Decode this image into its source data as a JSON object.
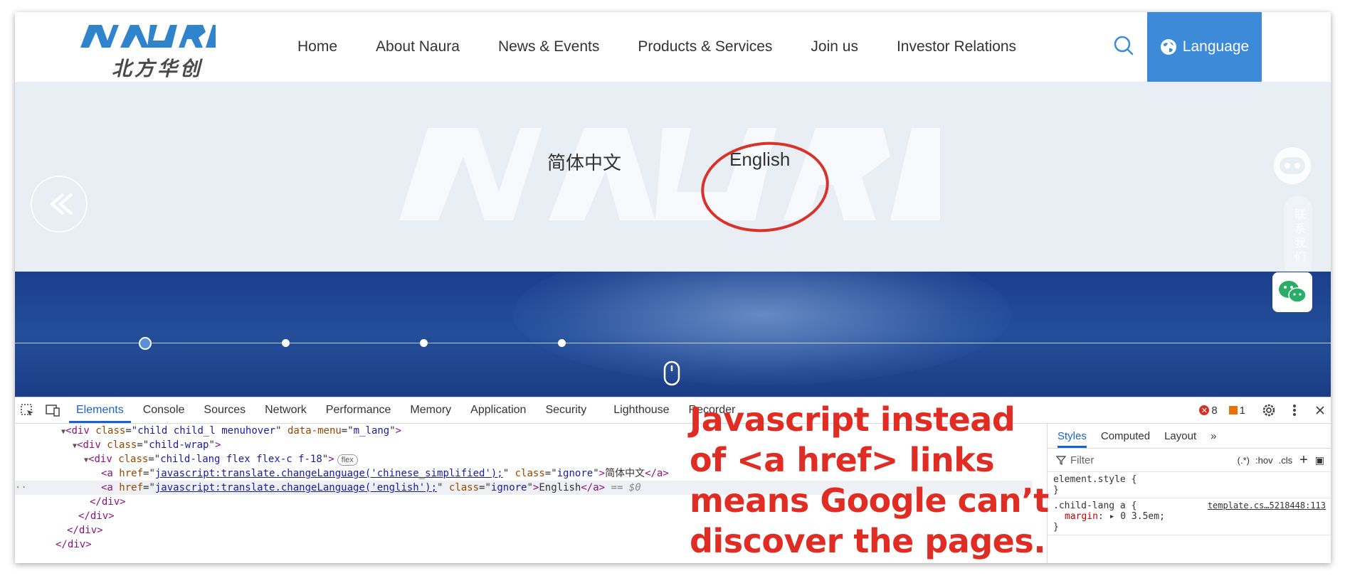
{
  "header": {
    "logo_text": "NAURA",
    "logo_cn": "北方华创",
    "nav": [
      "Home",
      "About Naura",
      "News & Events",
      "Products & Services",
      "Join us",
      "Investor Relations"
    ],
    "language_label": "Language",
    "accent_color": "#3d8bd8"
  },
  "language_panel": {
    "options": [
      "简体中文",
      "English"
    ],
    "highlighted": "English",
    "contact_tab": "联系我们",
    "circle_color": "#d9322b"
  },
  "devtools": {
    "tabs": [
      "Elements",
      "Console",
      "Sources",
      "Network",
      "Performance",
      "Memory",
      "Application",
      "Security",
      "Lighthouse",
      "Recorder"
    ],
    "active_tab": "Elements",
    "error_count": "8",
    "warning_count": "1",
    "elements_lines": [
      {
        "open": "<div",
        "attrs": [
          [
            "class",
            "child child_l menuhover"
          ],
          [
            "data-menu",
            "m_lang"
          ]
        ],
        "close": ">"
      },
      {
        "open": "<div",
        "attrs": [
          [
            "class",
            "child-wrap"
          ]
        ],
        "close": ">"
      },
      {
        "open": "<div",
        "attrs": [
          [
            "class",
            "child-lang flex flex-c f-18"
          ]
        ],
        "close": ">",
        "pill": "flex"
      },
      {
        "href": "javascript:translate.changeLanguage('chinese_simplified');",
        "class": "ignore",
        "text": "简体中文"
      },
      {
        "href": "javascript:translate.changeLanguage('english');",
        "class": "ignore",
        "text": "English",
        "suffix": " == $0"
      },
      {
        "text_only": "</div>"
      },
      {
        "text_only": "</div>"
      },
      {
        "text_only": "</div>"
      },
      {
        "text_only": "</div>"
      }
    ],
    "styles_tabs": [
      "Styles",
      "Computed",
      "Layout"
    ],
    "filter_placeholder": "Filter",
    "filter_tools": [
      ":hov",
      ".cls"
    ],
    "rules": [
      {
        "selector": "element.style {",
        "body": "}"
      },
      {
        "selector": ".child-lang a {",
        "source": "template.cs…5218448:113",
        "prop": "margin",
        "value": "0 3.5em;"
      }
    ]
  },
  "annotation": {
    "text": "Javascript instead of <a href> links means Google can’t discover the pages.",
    "color": "#e02c23"
  }
}
